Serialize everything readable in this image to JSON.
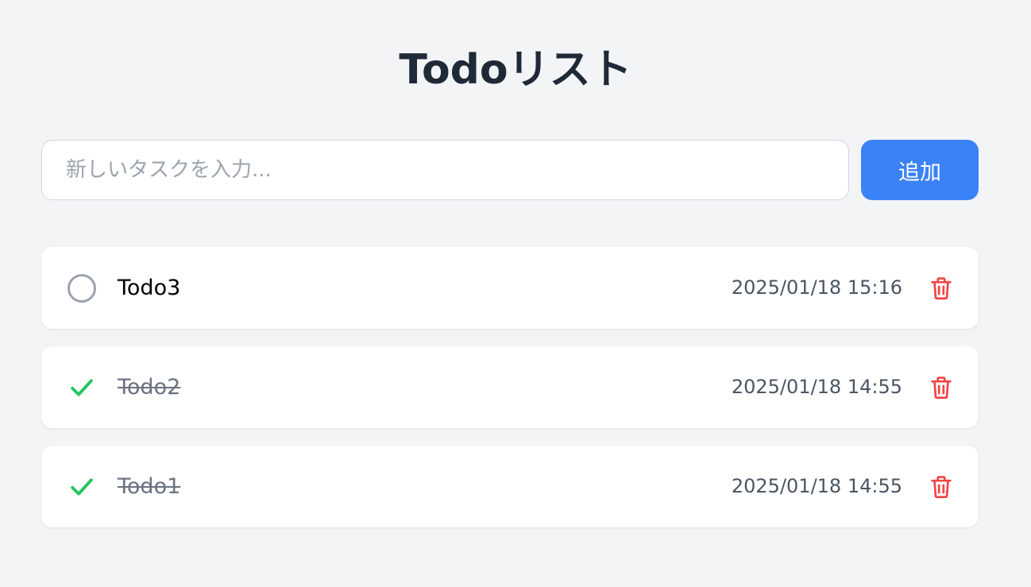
{
  "header": {
    "title": "Todoリスト"
  },
  "new_task": {
    "placeholder": "新しいタスクを入力...",
    "add_label": "追加"
  },
  "todos": [
    {
      "text": "Todo3",
      "timestamp": "2025/01/18 15:16",
      "completed": false
    },
    {
      "text": "Todo2",
      "timestamp": "2025/01/18 14:55",
      "completed": true
    },
    {
      "text": "Todo1",
      "timestamp": "2025/01/18 14:55",
      "completed": true
    }
  ],
  "icons": {
    "toggle_incomplete": "circle-icon",
    "toggle_complete": "check-icon",
    "delete": "trash-icon"
  },
  "colors": {
    "background": "#f3f4f6",
    "accent": "#3b82f6",
    "check": "#22c55e",
    "delete": "#ef4444",
    "incomplete_circle": "#9ca3af"
  }
}
